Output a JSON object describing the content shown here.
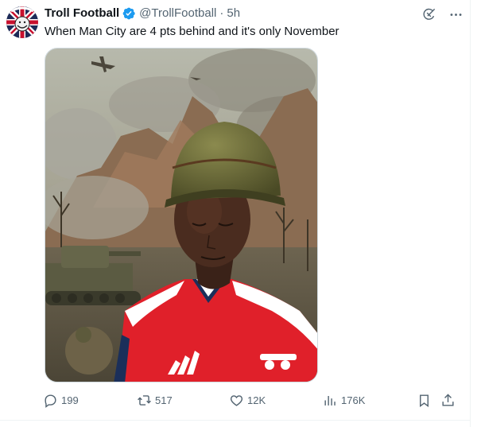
{
  "tweet": {
    "display_name": "Troll Football",
    "handle": "@TrollFootball",
    "separator": "·",
    "time": "5h",
    "text": "When Man City are 4 pts behind and it's only November",
    "avatar_icon": "troll-face-union-jack-icon",
    "verified_icon": "verified-badge-icon",
    "media": {
      "image_icon": "soldier-helmet-photo",
      "description_visible": false
    }
  },
  "top_actions": [
    {
      "icon": "grok-icon"
    },
    {
      "icon": "more-icon"
    }
  ],
  "actions": {
    "reply": {
      "icon": "reply-icon",
      "count": "199"
    },
    "retweet": {
      "icon": "retweet-icon",
      "count": "517"
    },
    "like": {
      "icon": "heart-icon",
      "count": "12K"
    },
    "views": {
      "icon": "views-icon",
      "count": "176K"
    },
    "bookmark": {
      "icon": "bookmark-icon"
    },
    "share": {
      "icon": "share-icon"
    }
  },
  "colors": {
    "text_primary": "#0f1419",
    "text_secondary": "#536471",
    "verified": "#1d9bf0",
    "arsenal_red": "#e0202a"
  }
}
